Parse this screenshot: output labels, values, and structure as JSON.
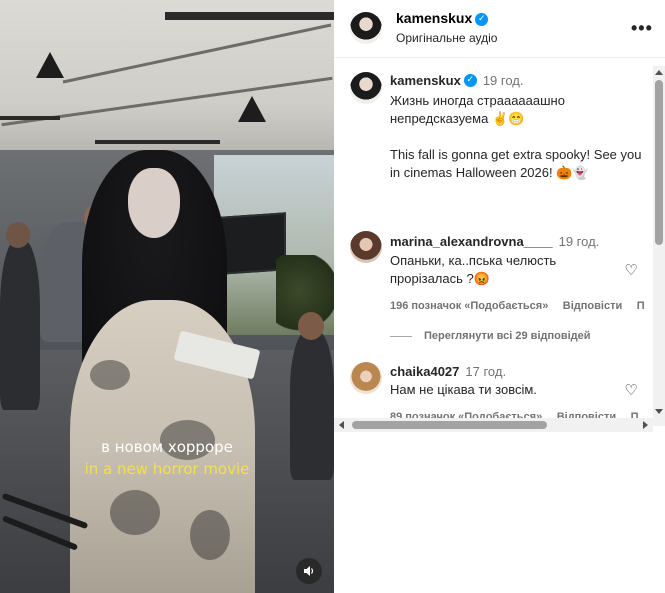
{
  "media": {
    "subtitle_ru": "в новом хорроре",
    "subtitle_en": "in a new horror movie",
    "mute_icon": "speaker-icon"
  },
  "post_header": {
    "username": "kamenskux",
    "verified": true,
    "audio_label": "Оригінальне аудіо",
    "more_label": "•••"
  },
  "caption": {
    "username": "kamenskux",
    "time": "19 год.",
    "lines": [
      "Жизнь иногда страааааашно непредсказуема ✌️😁",
      "This fall is gonna get extra spooky! See you in cinemas Halloween 2026! 🎃👻"
    ]
  },
  "comments": [
    {
      "username": "marina_alexandrovna____",
      "time": "19 год.",
      "text": "Опаньки, ка..пська челюсть прорізалась ?😡",
      "likes": "196 позначок «Подобається»",
      "reply": "Відповісти",
      "extra": "П"
    },
    {
      "username": "chaika4027",
      "time": "17 год.",
      "text": "Нам не цікава ти зовсім.",
      "likes": "89 позначок «Подобається»",
      "reply": "Відповісти",
      "extra": "П"
    }
  ],
  "view_replies_label": "Переглянути всі 29 відповідей",
  "colors": {
    "verified": "#0095f6",
    "subtitle_en": "#f4e04d",
    "muted_text": "#737373"
  }
}
